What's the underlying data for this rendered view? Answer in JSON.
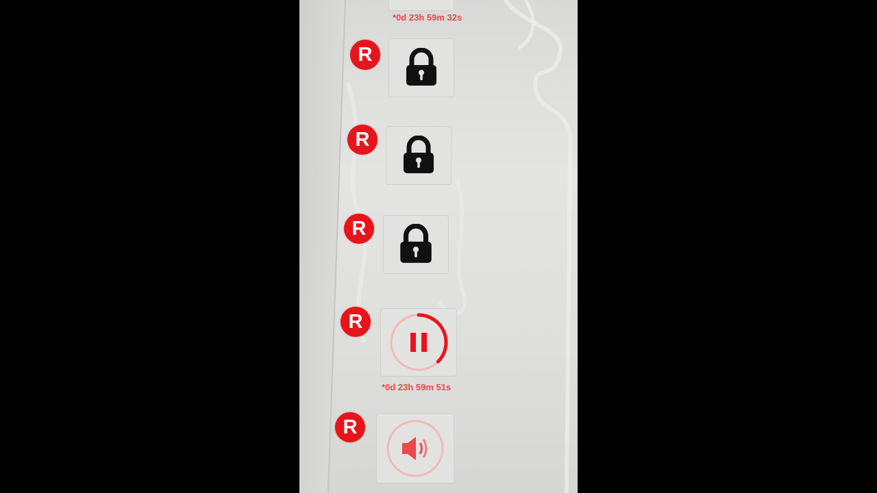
{
  "level_list": {
    "top_timer": "*0d 23h 59m 32s",
    "items": [
      {
        "badge": "R",
        "state": "locked",
        "icon": "lock-icon"
      },
      {
        "badge": "R",
        "state": "locked",
        "icon": "lock-icon"
      },
      {
        "badge": "R",
        "state": "locked",
        "icon": "lock-icon"
      },
      {
        "badge": "R",
        "state": "paused",
        "icon": "pause-icon",
        "timer": "*0d 23h 59m 51s",
        "progress": 0.3
      },
      {
        "badge": "R",
        "state": "audio",
        "icon": "speaker-icon"
      }
    ]
  },
  "colors": {
    "accent": "#e8141c",
    "background": "#e0e0de",
    "icon_dark": "#111111"
  }
}
